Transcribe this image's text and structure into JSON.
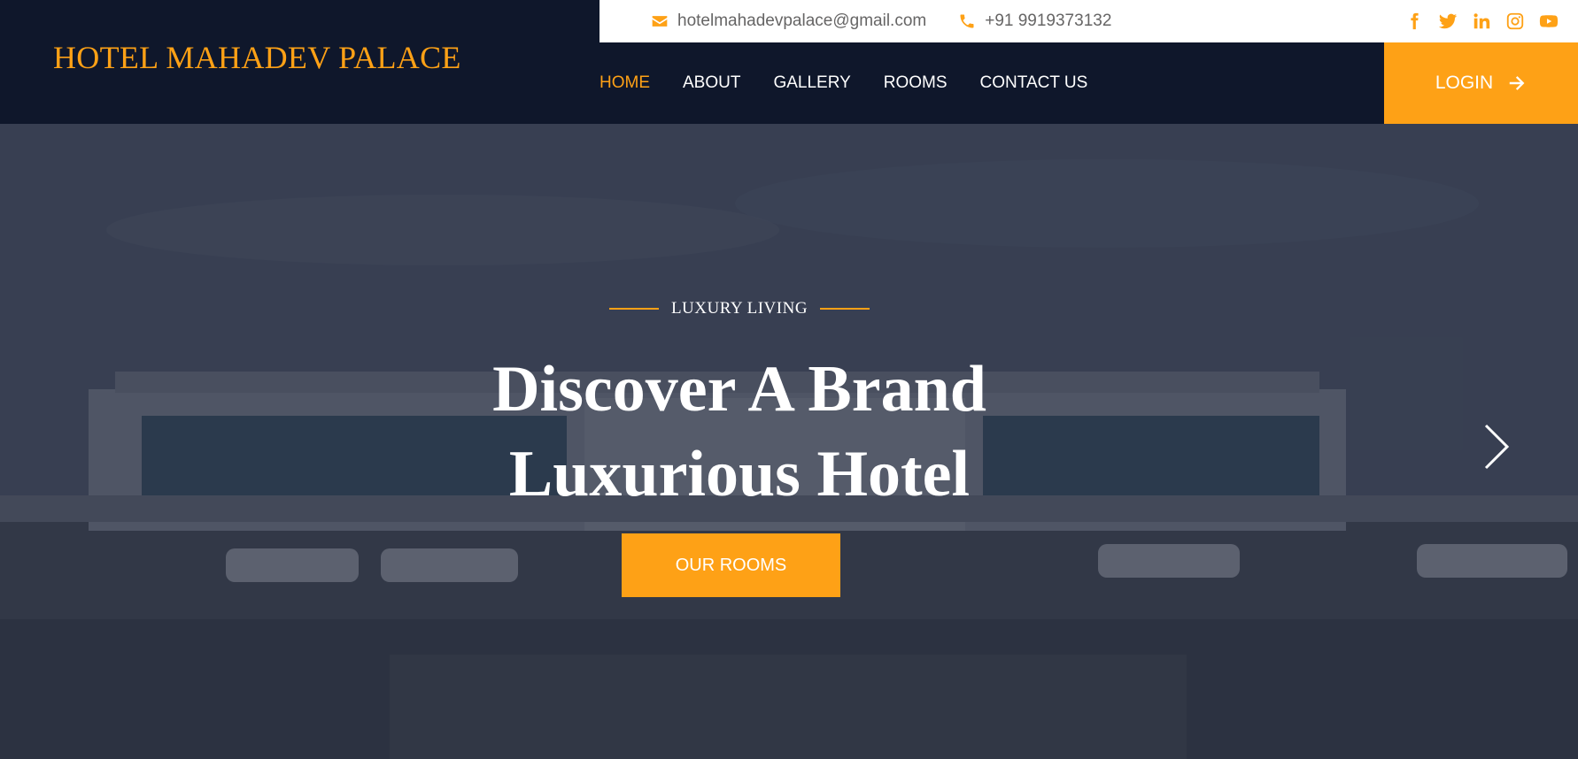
{
  "brand": {
    "name": "HOTEL MAHADEV PALACE"
  },
  "topbar": {
    "email": "hotelmahadevpalace@gmail.com",
    "phone": "+91 9919373132",
    "socials": [
      "facebook-icon",
      "twitter-icon",
      "linkedin-icon",
      "instagram-icon",
      "youtube-icon"
    ]
  },
  "nav": {
    "items": [
      {
        "label": "HOME",
        "active": true
      },
      {
        "label": "ABOUT",
        "active": false
      },
      {
        "label": "GALLERY",
        "active": false
      },
      {
        "label": "ROOMS",
        "active": false
      },
      {
        "label": "CONTACT US",
        "active": false
      }
    ],
    "login_label": "LOGIN"
  },
  "hero": {
    "eyebrow": "LUXURY LIVING",
    "headline_line1": "Discover A Brand",
    "headline_line2": "Luxurious Hotel",
    "cta_label": "OUR ROOMS"
  },
  "colors": {
    "accent": "#fea116",
    "dark": "#0f172b",
    "white": "#ffffff",
    "muted_text": "#666565"
  }
}
